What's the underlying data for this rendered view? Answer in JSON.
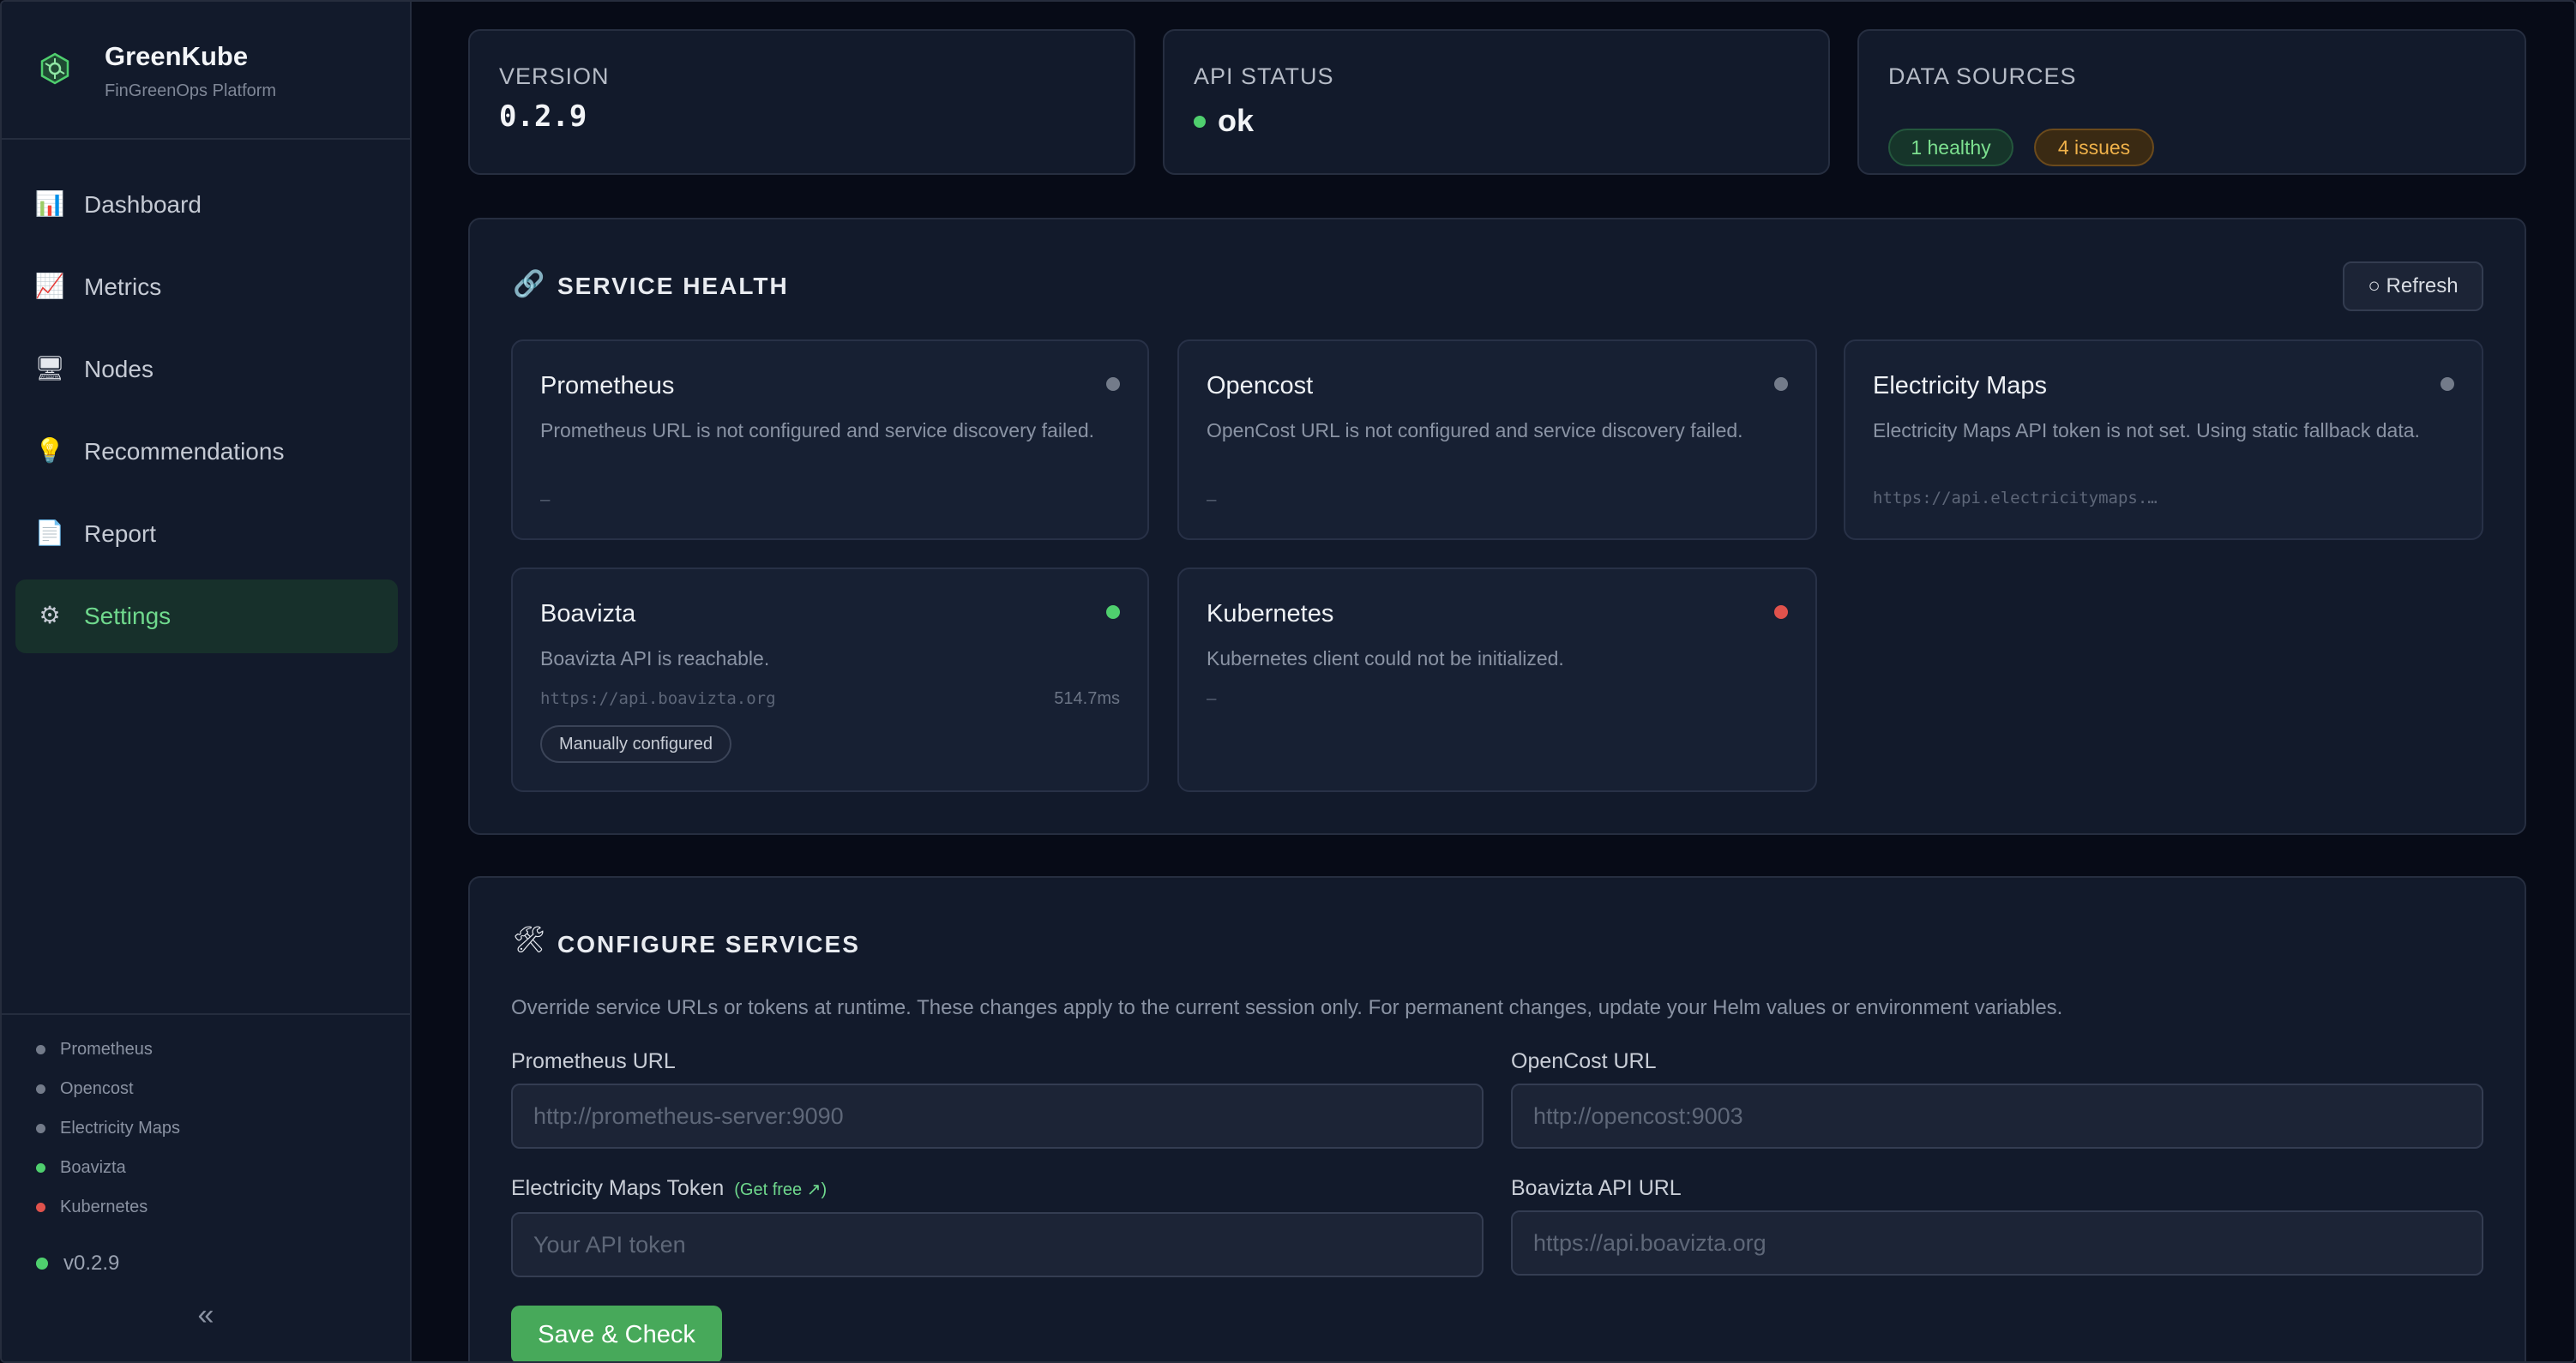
{
  "app": {
    "name": "GreenKube",
    "subtitle": "FinGreenOps Platform"
  },
  "sidebar": {
    "nav": [
      {
        "label": "Dashboard",
        "icon": "bar-chart-icon"
      },
      {
        "label": "Metrics",
        "icon": "trend-chart-icon"
      },
      {
        "label": "Nodes",
        "icon": "desktop-icon"
      },
      {
        "label": "Recommendations",
        "icon": "lightbulb-icon"
      },
      {
        "label": "Report",
        "icon": "document-icon"
      },
      {
        "label": "Settings",
        "icon": "gear-icon",
        "active": true
      }
    ],
    "services": [
      {
        "label": "Prometheus",
        "status": "unknown"
      },
      {
        "label": "Opencost",
        "status": "unknown"
      },
      {
        "label": "Electricity Maps",
        "status": "unknown"
      },
      {
        "label": "Boavizta",
        "status": "healthy"
      },
      {
        "label": "Kubernetes",
        "status": "error"
      }
    ],
    "version": "v0.2.9",
    "collapse_glyph": "«"
  },
  "stats": {
    "version": {
      "label": "VERSION",
      "value": "0.2.9"
    },
    "api_status": {
      "label": "API STATUS",
      "value": "ok"
    },
    "data_sources": {
      "label": "DATA SOURCES",
      "healthy": "1 healthy",
      "issues": "4 issues"
    }
  },
  "service_health": {
    "title": "SERVICE HEALTH",
    "refresh_label": "○ Refresh",
    "services": [
      {
        "name": "Prometheus",
        "description": "Prometheus URL is not configured and service discovery failed.",
        "url": "—",
        "status": "unknown"
      },
      {
        "name": "Opencost",
        "description": "OpenCost URL is not configured and service discovery failed.",
        "url": "—",
        "status": "unknown"
      },
      {
        "name": "Electricity Maps",
        "description": "Electricity Maps API token is not set. Using static fallback data.",
        "url": "https://api.electricitymaps.…",
        "status": "unknown"
      },
      {
        "name": "Boavizta",
        "description": "Boavizta API is reachable.",
        "url": "https://api.boavizta.org",
        "latency": "514.7ms",
        "badge": "Manually configured",
        "status": "healthy"
      },
      {
        "name": "Kubernetes",
        "description": "Kubernetes client could not be initialized.",
        "url": "—",
        "status": "error"
      }
    ]
  },
  "configure": {
    "title": "CONFIGURE SERVICES",
    "description": "Override service URLs or tokens at runtime. These changes apply to the current session only. For permanent changes, update your Helm values or environment variables.",
    "fields": {
      "prometheus": {
        "label": "Prometheus URL",
        "placeholder": "http://prometheus-server:9090"
      },
      "opencost": {
        "label": "OpenCost URL",
        "placeholder": "http://opencost:9003"
      },
      "electricity": {
        "label": "Electricity Maps Token",
        "link": "(Get free ↗)",
        "placeholder": "Your API token"
      },
      "boavizta": {
        "label": "Boavizta API URL",
        "placeholder": "https://api.boavizta.org"
      }
    },
    "save_label": "Save & Check"
  },
  "colors": {
    "accent_green": "#4fcf6e",
    "status_unknown": "#737b8a",
    "status_healthy": "#4fcf6e",
    "status_error": "#e0524c"
  }
}
